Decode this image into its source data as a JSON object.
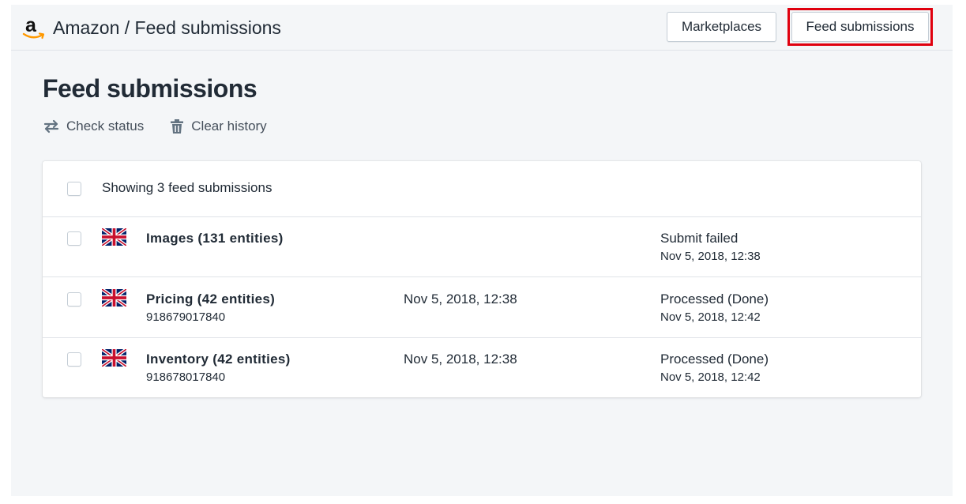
{
  "header": {
    "title": "Amazon / Feed submissions",
    "logo_letter": "a",
    "buttons": {
      "marketplaces": "Marketplaces",
      "feed_submissions": "Feed submissions"
    }
  },
  "page": {
    "title": "Feed submissions",
    "actions": {
      "check_status": "Check status",
      "clear_history": "Clear history"
    }
  },
  "list": {
    "summary": "Showing 3 feed submissions",
    "rows": [
      {
        "flag": "uk-flag-icon",
        "name": "Images (131 entities)",
        "id": "",
        "submitted": "",
        "status": "Submit failed",
        "status_time": "Nov 5, 2018, 12:38"
      },
      {
        "flag": "uk-flag-icon",
        "name": "Pricing (42 entities)",
        "id": "918679017840",
        "submitted": "Nov 5, 2018, 12:38",
        "status": "Processed (Done)",
        "status_time": "Nov 5, 2018, 12:42"
      },
      {
        "flag": "uk-flag-icon",
        "name": "Inventory (42 entities)",
        "id": "918678017840",
        "submitted": "Nov 5, 2018, 12:38",
        "status": "Processed (Done)",
        "status_time": "Nov 5, 2018, 12:42"
      }
    ]
  },
  "colors": {
    "background": "#f4f6f8",
    "text": "#212b36",
    "highlight": "#e0000e",
    "amazon_orange": "#ff9900"
  }
}
